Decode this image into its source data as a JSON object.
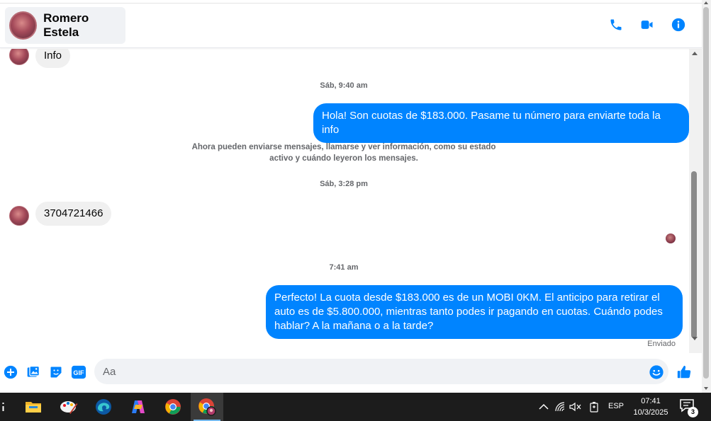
{
  "header": {
    "contact_name": "Romero Estela",
    "icons": [
      "phone-icon",
      "video-icon",
      "info-icon"
    ]
  },
  "messages": {
    "incoming_1": "Info",
    "ts_1": "Sáb, 9:40 am",
    "outgoing_1": "Hola! Son cuotas de $183.000. Pasame tu número para enviarte toda la info",
    "notice_line1": "Ahora pueden enviarse mensajes, llamarse y ver información, como su estado",
    "notice_line2": "activo y cuándo leyeron los mensajes.",
    "ts_2": "Sáb, 3:28 pm",
    "incoming_2": "3704721466",
    "ts_3": "7:41 am",
    "outgoing_2_line1": "Perfecto! La cuota desde $183.000 es de un MOBI 0KM. El anticipo para retirar el",
    "outgoing_2_line2": "auto es de $5.800.000, mientras tanto podes ir pagando en cuotas. Cuándo podes",
    "outgoing_2_line3": "hablar? A la mañana o a la tarde?",
    "status": "Enviado"
  },
  "composer": {
    "placeholder": "Aa",
    "icons": [
      "plus-icon",
      "gallery-icon",
      "sticker-icon",
      "gif-icon",
      "emoji-icon",
      "thumbs-up-icon"
    ],
    "gif_label": "GIF"
  },
  "taskbar": {
    "apps": [
      "file-explorer-icon",
      "paint-icon",
      "edge-icon",
      "copilot-icon",
      "chrome-icon",
      "chrome-profile-icon"
    ],
    "lang": "ESP",
    "time": "07:41",
    "date": "10/3/2025",
    "notif_count": "3"
  },
  "colors": {
    "accent": "#0084ff",
    "bubble_in": "#f0f0f0",
    "taskbar": "#1c1c1c"
  }
}
